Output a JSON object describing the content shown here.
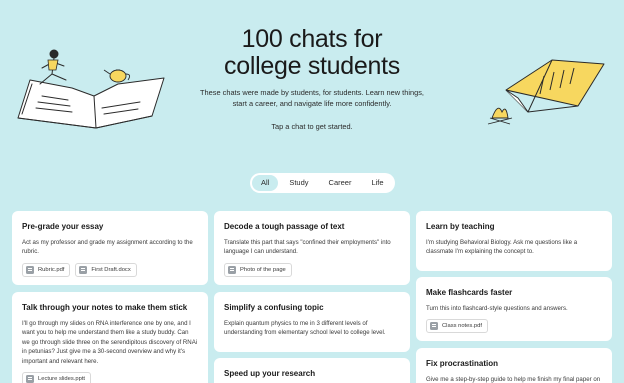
{
  "hero": {
    "title_line1": "100 chats for",
    "title_line2": "college students",
    "subtitle": "These chats were made by students, for students. Learn new things, start a career, and navigate life more confidently.",
    "cta": "Tap a chat to get started."
  },
  "filters": [
    {
      "label": "All",
      "active": true
    },
    {
      "label": "Study",
      "active": false
    },
    {
      "label": "Career",
      "active": false
    },
    {
      "label": "Life",
      "active": false
    }
  ],
  "cards": {
    "pregrade": {
      "title": "Pre-grade your essay",
      "body": "Act as my professor and grade my assignment according to the rubric.",
      "files": [
        "Rubric.pdf",
        "First Draft.docx"
      ]
    },
    "decode": {
      "title": "Decode a tough passage of text",
      "body": "Translate this part that says \"confined their employments\" into language I can understand.",
      "files": [
        "Photo of the page"
      ]
    },
    "teaching": {
      "title": "Learn by teaching",
      "body": "I'm studying Behavioral Biology. Ask me questions like a classmate I'm explaining the concept to.",
      "files": []
    },
    "talk": {
      "title": "Talk through your notes to make them stick",
      "body": "I'll go through my slides on RNA interference one by one, and I want you to help me understand them like a study buddy. Can we go through slide three on the serendipitous discovery of RNAi in petunias? Just give me a 30-second overview and why it's important and relevant here.",
      "files": [
        "Lecture slides.pptt"
      ]
    },
    "simplify": {
      "title": "Simplify a confusing topic",
      "body": "Explain quantum physics to me in 3 different levels of understanding from elementary school level to college level.",
      "files": []
    },
    "flashcards": {
      "title": "Make flashcards faster",
      "body": "Turn this into flashcard-style questions and answers.",
      "files": [
        "Class notes.pdf"
      ]
    },
    "speed": {
      "title": "Speed up your research",
      "body": "",
      "files": []
    },
    "procrastination": {
      "title": "Fix procrastination",
      "body": "Give me a step-by-step guide to help me finish my final paper on",
      "files": []
    }
  }
}
